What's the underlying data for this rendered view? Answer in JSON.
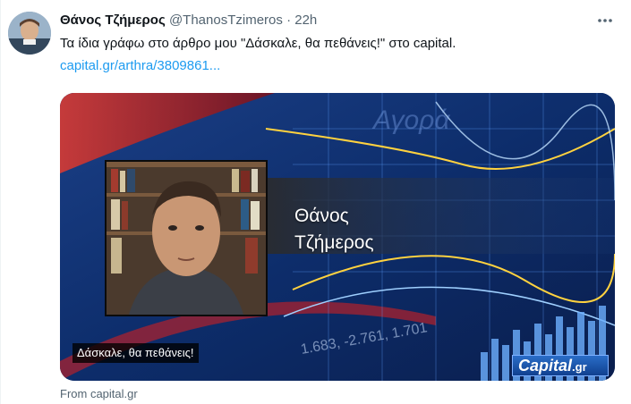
{
  "tweet": {
    "author_name": "Θάνος Τζήμερος",
    "author_handle": "@ThanosTzimeros",
    "separator": "·",
    "time": "22h",
    "text": "Τα ίδια γράφω στο άρθρο μου \"Δάσκαλε, θα πεθάνεις!\" στο capital.",
    "link": "capital.gr/arthra/3809861..."
  },
  "card": {
    "name_first": "Θάνος",
    "name_last": "Τζήμερος",
    "background_text": "Αγορά",
    "headline": "Δάσκαλε, θα πεθάνεις!",
    "ticker_numbers": "1.683, -2.761, 1.701",
    "brand_main": "Capital",
    "brand_suffix": ".gr",
    "source": "From capital.gr"
  },
  "icons": {
    "more": "more-horizontal-icon"
  },
  "colors": {
    "link": "#1d9bf0",
    "text_primary": "#0f1419",
    "text_secondary": "#536471",
    "card_bg": "#0b2a63",
    "accent_red": "#c0202a"
  }
}
